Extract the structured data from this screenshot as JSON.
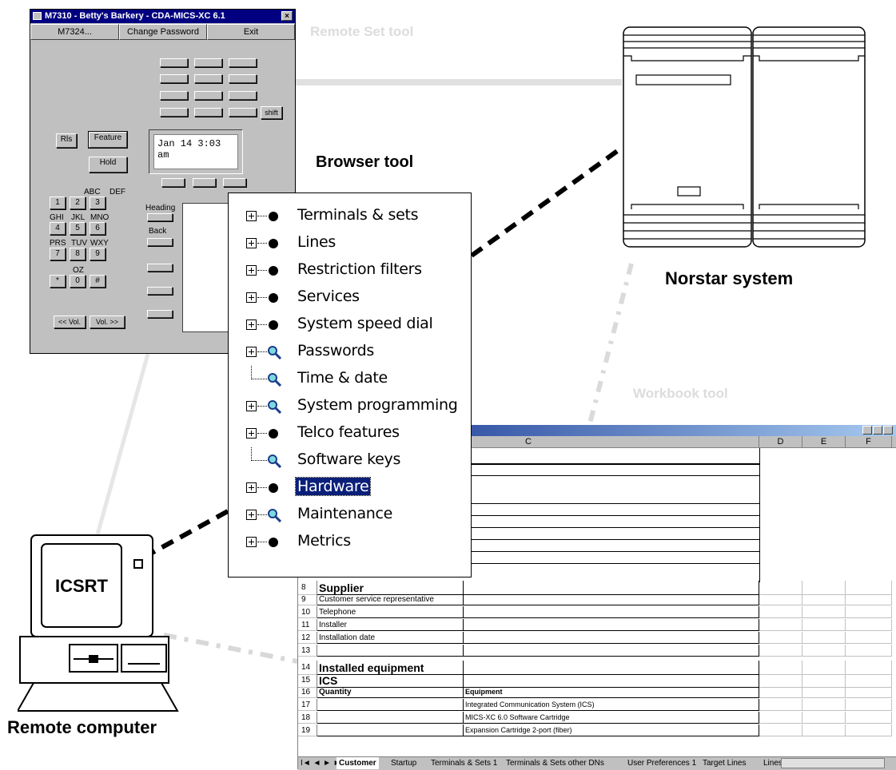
{
  "labels": {
    "remote_set_tool": "Remote Set tool",
    "browser_tool": "Browser tool",
    "norstar_system": "Norstar system",
    "workbook_tool": "Workbook tool",
    "remote_computer": "Remote computer",
    "computer_screen": "ICSRT"
  },
  "phone_window": {
    "title": "M7310 - Betty's Barkery - CDA-MICS-XC 6.1",
    "close_glyph": "×",
    "menu": [
      "M7324...",
      "Change Password",
      "Exit"
    ],
    "shift": "shift",
    "rls": "Rls",
    "feature": "Feature",
    "hold": "Hold",
    "display_text": "Jan 14 3:03 am",
    "heading": "Heading",
    "back": "Back",
    "vol_down": "<< Vol.",
    "vol_up": "Vol. >>",
    "key_letters": [
      "ABC",
      "DEF",
      "GHI",
      "JKL",
      "MNO",
      "PRS",
      "TUV",
      "WXY",
      "OZ"
    ],
    "keys": [
      "1",
      "2",
      "3",
      "4",
      "5",
      "6",
      "7",
      "8",
      "9",
      "*",
      "0",
      "#"
    ]
  },
  "tree": {
    "items": [
      {
        "label": "Terminals & sets",
        "icon": "bullet",
        "expander": true
      },
      {
        "label": "Lines",
        "icon": "bullet",
        "expander": true
      },
      {
        "label": "Restriction filters",
        "icon": "bullet",
        "expander": true
      },
      {
        "label": "Services",
        "icon": "bullet",
        "expander": true
      },
      {
        "label": "System speed dial",
        "icon": "bullet",
        "expander": true
      },
      {
        "label": "Passwords",
        "icon": "magnifier",
        "expander": true
      },
      {
        "label": "Time & date",
        "icon": "magnifier",
        "expander": false
      },
      {
        "label": "System programming",
        "icon": "magnifier",
        "expander": true
      },
      {
        "label": "Telco features",
        "icon": "bullet",
        "expander": true
      },
      {
        "label": "Software keys",
        "icon": "magnifier",
        "expander": false
      },
      {
        "label": "Hardware",
        "icon": "bullet",
        "expander": true,
        "selected": true
      },
      {
        "label": "Maintenance",
        "icon": "magnifier",
        "expander": true
      },
      {
        "label": "Metrics",
        "icon": "bullet",
        "expander": true
      }
    ]
  },
  "workbook": {
    "columns": [
      "C",
      "D",
      "E",
      "F"
    ],
    "rows": [
      {
        "n": "8",
        "b": "Supplier",
        "c": "",
        "style": "section"
      },
      {
        "n": "9",
        "b": "Customer service representative",
        "c": ""
      },
      {
        "n": "10",
        "b": "Telephone",
        "c": ""
      },
      {
        "n": "11",
        "b": "Installer",
        "c": ""
      },
      {
        "n": "12",
        "b": "Installation date",
        "c": ""
      },
      {
        "n": "13",
        "b": "",
        "c": ""
      },
      {
        "n": "14",
        "b": "Installed equipment",
        "c": "",
        "style": "section"
      },
      {
        "n": "15",
        "b": "ICS",
        "c": "",
        "style": "section"
      },
      {
        "n": "16",
        "b": "Quantity",
        "c": "Equipment",
        "style": "bold"
      },
      {
        "n": "17",
        "b": "",
        "c": "Integrated Communication System (ICS)"
      },
      {
        "n": "18",
        "b": "",
        "c": "MICS-XC 6.0 Software Cartridge"
      },
      {
        "n": "19",
        "b": "",
        "c": "Expansion Cartridge 2-port (fiber)"
      }
    ],
    "sheet_tabs": [
      "Customer",
      "Startup",
      "Terminals & Sets 1",
      "Terminals & Sets other DNs",
      "User Preferences 1",
      "Target Lines",
      "Lines i"
    ],
    "nav_arrows": "I◄ ◄ ► ►I"
  }
}
